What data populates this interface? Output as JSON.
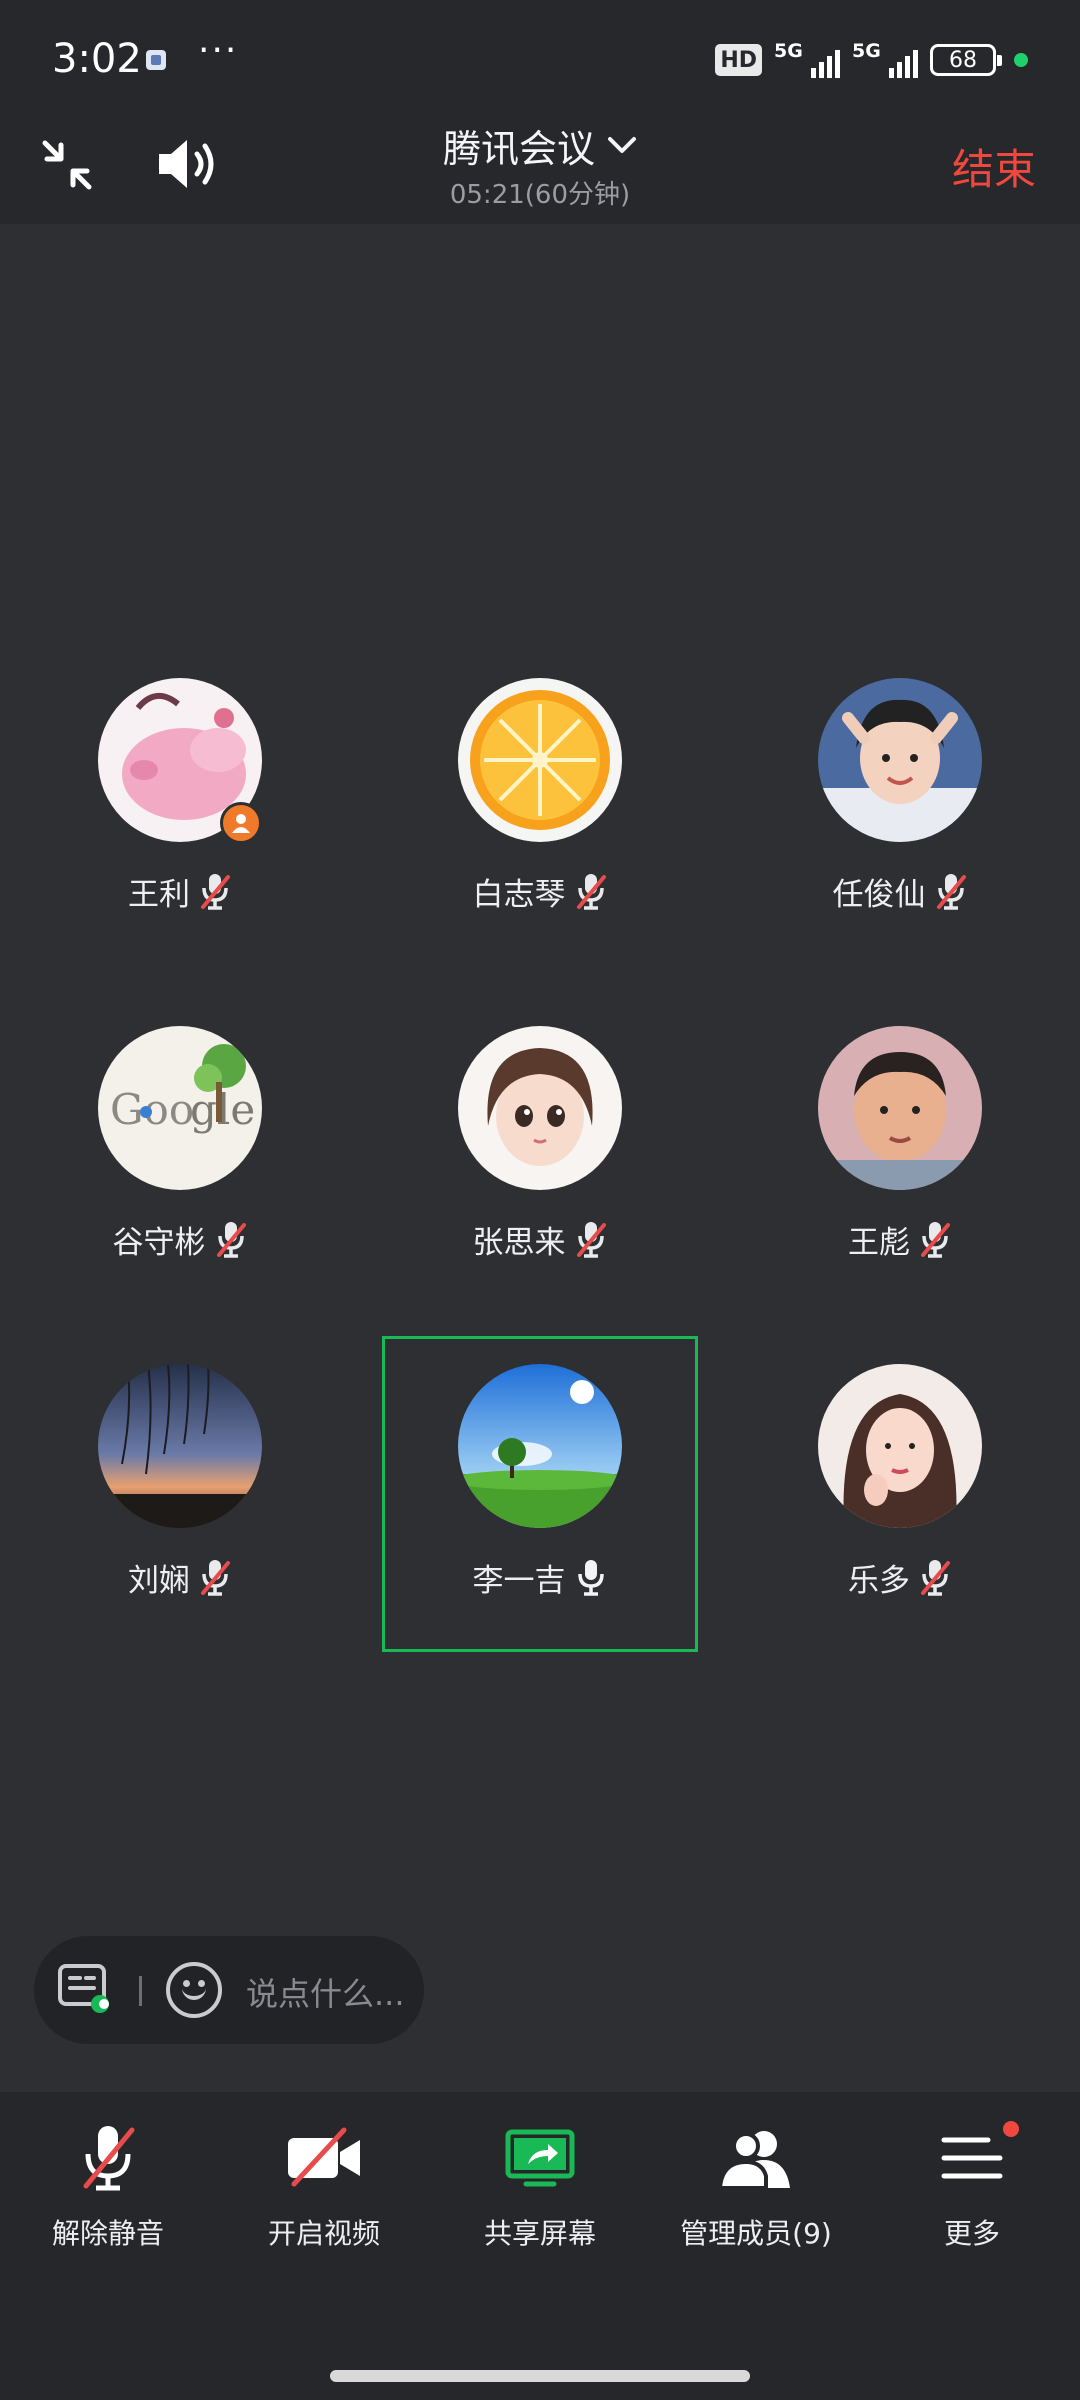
{
  "status_bar": {
    "time": "3:02",
    "dots": "···",
    "hd_badge": "HD",
    "signal1": "5G",
    "signal2": "5G",
    "battery": "68"
  },
  "header": {
    "title": "腾讯会议",
    "timer": "05:21(60分钟)",
    "end_label": "结束"
  },
  "participants": [
    {
      "name": "王利",
      "mic": "muted",
      "host": true
    },
    {
      "name": "白志琴",
      "mic": "muted"
    },
    {
      "name": "任俊仙",
      "mic": "muted"
    },
    {
      "name": "谷守彬",
      "mic": "muted"
    },
    {
      "name": "张思来",
      "mic": "muted"
    },
    {
      "name": "王彪",
      "mic": "muted"
    },
    {
      "name": "刘娴",
      "mic": "muted"
    },
    {
      "name": "李一吉",
      "mic": "on",
      "speaking": true
    },
    {
      "name": "乐多",
      "mic": "muted"
    }
  ],
  "chat": {
    "placeholder": "说点什么..."
  },
  "toolbar": {
    "unmute_label": "解除静音",
    "video_label": "开启视频",
    "share_label": "共享屏幕",
    "members_label": "管理成员(9)",
    "more_label": "更多"
  },
  "colors": {
    "accent_green": "#19b955",
    "end_red": "#f0483e",
    "background": "#2d2f32"
  }
}
